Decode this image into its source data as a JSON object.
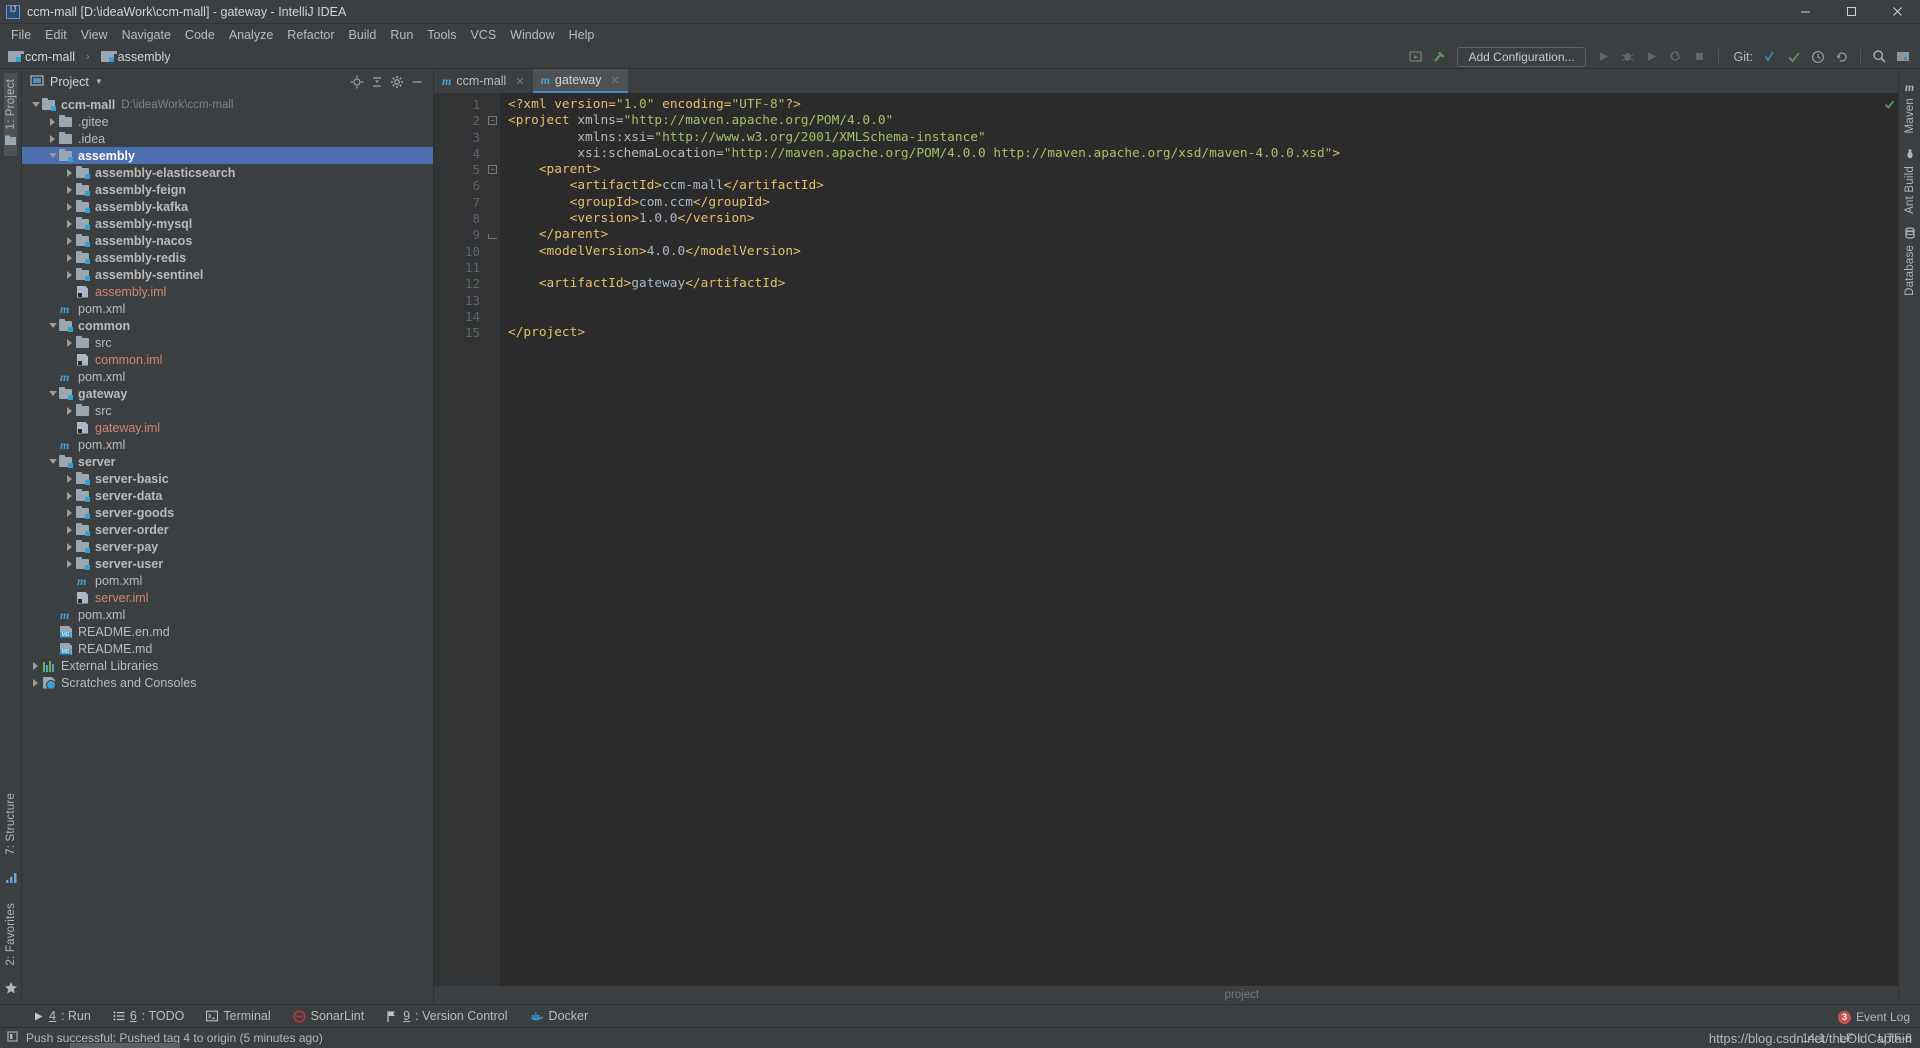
{
  "window": {
    "title": "ccm-mall [D:\\ideaWork\\ccm-mall] - gateway - IntelliJ IDEA",
    "logo_icon": "intellij-idea-logo",
    "minimize_icon": "minimize-icon",
    "maximize_icon": "maximize-icon",
    "close_icon": "close-icon"
  },
  "menubar": {
    "items": [
      {
        "label": "File"
      },
      {
        "label": "Edit"
      },
      {
        "label": "View"
      },
      {
        "label": "Navigate"
      },
      {
        "label": "Code"
      },
      {
        "label": "Analyze"
      },
      {
        "label": "Refactor"
      },
      {
        "label": "Build"
      },
      {
        "label": "Run"
      },
      {
        "label": "Tools"
      },
      {
        "label": "VCS"
      },
      {
        "label": "Window"
      },
      {
        "label": "Help"
      }
    ]
  },
  "navbar": {
    "breadcrumb": [
      {
        "label": "ccm-mall",
        "icon": "module-icon"
      },
      {
        "label": "assembly",
        "icon": "module-icon"
      }
    ],
    "separator": "›",
    "add_configuration_label": "Add Configuration...",
    "git_label": "Git:",
    "icons": [
      "select-in-icon",
      "build-hammer-icon",
      "run-icon",
      "debug-icon",
      "run-with-coverage-icon",
      "profile-icon",
      "stop-icon",
      "git-update-icon",
      "git-commit-icon",
      "git-history-icon",
      "git-rollback-icon",
      "search-everywhere-icon",
      "project-structure-icon"
    ]
  },
  "left_strip": {
    "project_tab": "1: Project",
    "structure_tab": "7: Structure",
    "favorites_tab": "2: Favorites",
    "project_icon": "project-tool-icon",
    "structure_icon": "structure-tool-icon",
    "favorites_icon": "favorites-star-icon"
  },
  "right_strip": {
    "tabs": [
      {
        "label": "Maven",
        "icon": "maven-icon"
      },
      {
        "label": "Ant Build",
        "icon": "ant-icon"
      },
      {
        "label": "Database",
        "icon": "database-icon"
      }
    ]
  },
  "project_panel": {
    "title": "Project",
    "dropdown_icon": "chevron-down-icon",
    "header_icons": [
      "locate-icon",
      "collapse-all-icon",
      "settings-gear-icon",
      "hide-icon"
    ],
    "tree": [
      {
        "depth": 0,
        "label": "ccm-mall",
        "suffix": "D:\\ideaWork\\ccm-mall",
        "icon": "module-folder-icon",
        "twisty": "open",
        "bold": true
      },
      {
        "depth": 1,
        "label": ".gitee",
        "icon": "folder-icon",
        "twisty": "closed"
      },
      {
        "depth": 1,
        "label": ".idea",
        "icon": "folder-icon",
        "twisty": "closed"
      },
      {
        "depth": 1,
        "label": "assembly",
        "icon": "module-folder-icon",
        "twisty": "open",
        "bold": true,
        "selected": true
      },
      {
        "depth": 2,
        "label": "assembly-elasticsearch",
        "icon": "module-folder-icon",
        "twisty": "closed",
        "bold": true
      },
      {
        "depth": 2,
        "label": "assembly-feign",
        "icon": "module-folder-icon",
        "twisty": "closed",
        "bold": true
      },
      {
        "depth": 2,
        "label": "assembly-kafka",
        "icon": "module-folder-icon",
        "twisty": "closed",
        "bold": true
      },
      {
        "depth": 2,
        "label": "assembly-mysql",
        "icon": "module-folder-icon",
        "twisty": "closed",
        "bold": true
      },
      {
        "depth": 2,
        "label": "assembly-nacos",
        "icon": "module-folder-icon",
        "twisty": "closed",
        "bold": true
      },
      {
        "depth": 2,
        "label": "assembly-redis",
        "icon": "module-folder-icon",
        "twisty": "closed",
        "bold": true
      },
      {
        "depth": 2,
        "label": "assembly-sentinel",
        "icon": "module-folder-icon",
        "twisty": "closed",
        "bold": true
      },
      {
        "depth": 2,
        "label": "assembly.iml",
        "icon": "iml-file-icon",
        "twisty": "none",
        "iml": true
      },
      {
        "depth": 1,
        "label": "pom.xml",
        "icon": "maven-pom-icon",
        "twisty": "none"
      },
      {
        "depth": 1,
        "label": "common",
        "icon": "module-folder-icon",
        "twisty": "open",
        "bold": true
      },
      {
        "depth": 2,
        "label": "src",
        "icon": "folder-icon",
        "twisty": "closed"
      },
      {
        "depth": 2,
        "label": "common.iml",
        "icon": "iml-file-icon",
        "twisty": "none",
        "iml": true
      },
      {
        "depth": 1,
        "label": "pom.xml",
        "icon": "maven-pom-icon",
        "twisty": "none"
      },
      {
        "depth": 1,
        "label": "gateway",
        "icon": "module-folder-icon",
        "twisty": "open",
        "bold": true
      },
      {
        "depth": 2,
        "label": "src",
        "icon": "folder-icon",
        "twisty": "closed"
      },
      {
        "depth": 2,
        "label": "gateway.iml",
        "icon": "iml-file-icon",
        "twisty": "none",
        "iml": true
      },
      {
        "depth": 1,
        "label": "pom.xml",
        "icon": "maven-pom-icon",
        "twisty": "none"
      },
      {
        "depth": 1,
        "label": "server",
        "icon": "module-folder-icon",
        "twisty": "open",
        "bold": true
      },
      {
        "depth": 2,
        "label": "server-basic",
        "icon": "module-folder-icon",
        "twisty": "closed",
        "bold": true
      },
      {
        "depth": 2,
        "label": "server-data",
        "icon": "module-folder-icon",
        "twisty": "closed",
        "bold": true
      },
      {
        "depth": 2,
        "label": "server-goods",
        "icon": "module-folder-icon",
        "twisty": "closed",
        "bold": true
      },
      {
        "depth": 2,
        "label": "server-order",
        "icon": "module-folder-icon",
        "twisty": "closed",
        "bold": true
      },
      {
        "depth": 2,
        "label": "server-pay",
        "icon": "module-folder-icon",
        "twisty": "closed",
        "bold": true
      },
      {
        "depth": 2,
        "label": "server-user",
        "icon": "module-folder-icon",
        "twisty": "closed",
        "bold": true
      },
      {
        "depth": 2,
        "label": "pom.xml",
        "icon": "maven-pom-icon",
        "twisty": "none"
      },
      {
        "depth": 2,
        "label": "server.iml",
        "icon": "iml-file-icon",
        "twisty": "none",
        "iml": true
      },
      {
        "depth": 1,
        "label": "pom.xml",
        "icon": "maven-pom-icon",
        "twisty": "none"
      },
      {
        "depth": 1,
        "label": "README.en.md",
        "icon": "markdown-file-icon",
        "twisty": "none"
      },
      {
        "depth": 1,
        "label": "README.md",
        "icon": "markdown-file-icon",
        "twisty": "none"
      },
      {
        "depth": 0,
        "label": "External Libraries",
        "icon": "libraries-icon",
        "twisty": "closed"
      },
      {
        "depth": 0,
        "label": "Scratches and Consoles",
        "icon": "scratches-icon",
        "twisty": "closed"
      }
    ]
  },
  "editor": {
    "tabs": [
      {
        "label": "ccm-mall",
        "icon": "maven-pom-icon",
        "active": false,
        "close_icon": "close-icon"
      },
      {
        "label": "gateway",
        "icon": "maven-pom-icon",
        "active": true,
        "close_icon": "close-icon"
      }
    ],
    "breadcrumb_footer": "project",
    "line_count": 15,
    "lines": [
      {
        "n": 1,
        "tokens": [
          {
            "t": "<?xml version=",
            "c": "pi"
          },
          {
            "t": "\"1.0\"",
            "c": "val"
          },
          {
            "t": " encoding=",
            "c": "pi"
          },
          {
            "t": "\"UTF-8\"",
            "c": "val"
          },
          {
            "t": "?>",
            "c": "pi"
          }
        ]
      },
      {
        "n": 2,
        "tokens": [
          {
            "t": "<project",
            "c": "tag"
          },
          {
            "t": " xmlns=",
            "c": "attr"
          },
          {
            "t": "\"http://maven.apache.org/POM/4.0.0\"",
            "c": "val"
          }
        ]
      },
      {
        "n": 3,
        "tokens": [
          {
            "t": "         xmlns:xsi=",
            "c": "attr"
          },
          {
            "t": "\"http://www.w3.org/2001/XMLSchema-instance\"",
            "c": "val"
          }
        ]
      },
      {
        "n": 4,
        "tokens": [
          {
            "t": "         xsi:schemaLocation=",
            "c": "attr"
          },
          {
            "t": "\"http://maven.apache.org/POM/4.0.0 http://maven.apache.org/xsd/maven-4.0.0.xsd\"",
            "c": "val"
          },
          {
            "t": ">",
            "c": "tag"
          }
        ]
      },
      {
        "n": 5,
        "tokens": [
          {
            "t": "    ",
            "c": "txt"
          },
          {
            "t": "<parent>",
            "c": "tag"
          }
        ]
      },
      {
        "n": 6,
        "tokens": [
          {
            "t": "        ",
            "c": "txt"
          },
          {
            "t": "<artifactId>",
            "c": "tag"
          },
          {
            "t": "ccm-mall",
            "c": "txt"
          },
          {
            "t": "</artifactId>",
            "c": "tag"
          }
        ]
      },
      {
        "n": 7,
        "tokens": [
          {
            "t": "        ",
            "c": "txt"
          },
          {
            "t": "<groupId>",
            "c": "tag"
          },
          {
            "t": "com.ccm",
            "c": "txt"
          },
          {
            "t": "</groupId>",
            "c": "tag"
          }
        ]
      },
      {
        "n": 8,
        "tokens": [
          {
            "t": "        ",
            "c": "txt"
          },
          {
            "t": "<version>",
            "c": "tag"
          },
          {
            "t": "1.0.0",
            "c": "txt"
          },
          {
            "t": "</version>",
            "c": "tag"
          }
        ]
      },
      {
        "n": 9,
        "tokens": [
          {
            "t": "    ",
            "c": "txt"
          },
          {
            "t": "</parent>",
            "c": "tag"
          }
        ]
      },
      {
        "n": 10,
        "tokens": [
          {
            "t": "    ",
            "c": "txt"
          },
          {
            "t": "<modelVersion>",
            "c": "tag"
          },
          {
            "t": "4.0.0",
            "c": "txt"
          },
          {
            "t": "</modelVersion>",
            "c": "tag"
          }
        ]
      },
      {
        "n": 11,
        "tokens": []
      },
      {
        "n": 12,
        "tokens": [
          {
            "t": "    ",
            "c": "txt"
          },
          {
            "t": "<artifactId>",
            "c": "tag"
          },
          {
            "t": "gateway",
            "c": "txt"
          },
          {
            "t": "</artifactId>",
            "c": "tag"
          }
        ]
      },
      {
        "n": 13,
        "tokens": []
      },
      {
        "n": 14,
        "tokens": []
      },
      {
        "n": 15,
        "tokens": [
          {
            "t": "</project>",
            "c": "tag"
          }
        ]
      }
    ]
  },
  "bottom_bar": {
    "items": [
      {
        "num": "4",
        "label": ": Run",
        "icon": "run-icon"
      },
      {
        "num": "6",
        "label": ": TODO",
        "icon": "todo-icon"
      },
      {
        "num": "",
        "label": "Terminal",
        "icon": "terminal-icon"
      },
      {
        "num": "",
        "label": "SonarLint",
        "icon": "sonarlint-icon"
      },
      {
        "num": "9",
        "label": ": Version Control",
        "icon": "version-control-icon"
      },
      {
        "num": "",
        "label": "Docker",
        "icon": "docker-icon"
      }
    ],
    "event_log_label": "Event Log",
    "event_log_count": "3"
  },
  "statusbar": {
    "message": "Push successful: Pushed tag 4 to origin (5 minutes ago)",
    "message_icon": "notification-icon",
    "caret_position": "14:1",
    "line_separator": "LF",
    "line_separator_icon": "updown-icon",
    "encoding": "UTF-8",
    "watermark": "https://blog.csdn.net/theOldCaptain"
  },
  "colors": {
    "accent": "#4b6eaf",
    "panel_bg": "#3c3f41",
    "editor_bg": "#2b2b2b",
    "gutter_bg": "#313335",
    "text": "#bbbbbb",
    "iml_file": "#d08770",
    "tag": "#e8bf6a",
    "string": "#a5c261",
    "badge_red": "#c75450",
    "folder_badge": "#389fd6"
  }
}
